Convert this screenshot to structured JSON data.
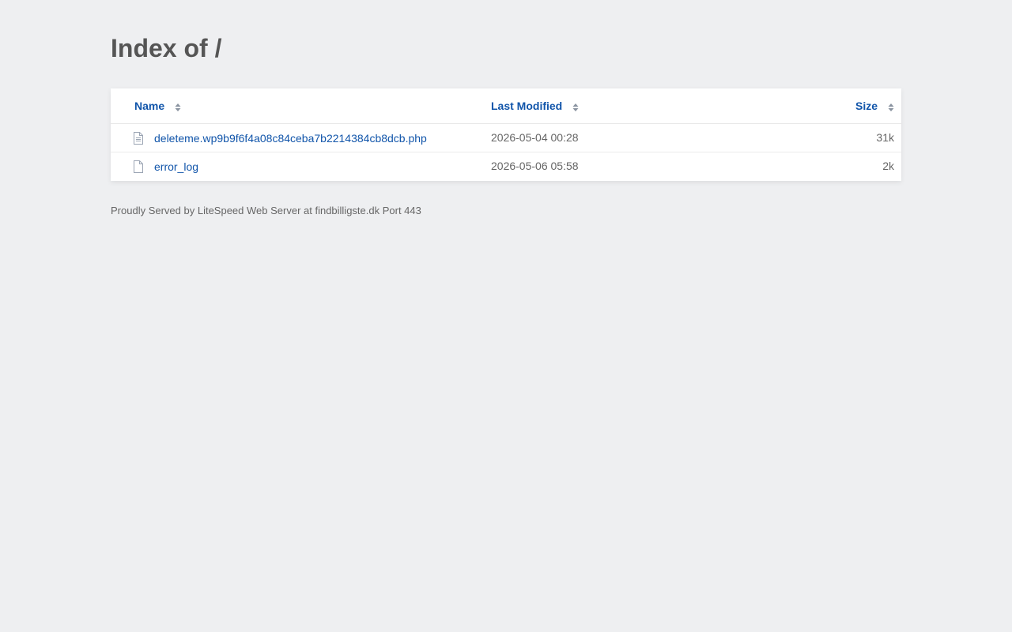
{
  "title": "Index of /",
  "columns": {
    "name": "Name",
    "last_modified": "Last Modified",
    "size": "Size"
  },
  "files": [
    {
      "icon": "text-file-icon",
      "name": "deleteme.wp9b9f6f4a08c84ceba7b2214384cb8dcb.php",
      "modified": "2026-05-04 00:28",
      "size": "31k"
    },
    {
      "icon": "file-icon",
      "name": "error_log",
      "modified": "2026-05-06 05:58",
      "size": "2k"
    }
  ],
  "footer": "Proudly Served by LiteSpeed Web Server at findbilligste.dk Port 443",
  "colors": {
    "background": "#eeeff1",
    "link": "#1155aa",
    "heading": "#555555",
    "muted_text": "#666666",
    "icon_stroke": "#9aa4b3"
  }
}
